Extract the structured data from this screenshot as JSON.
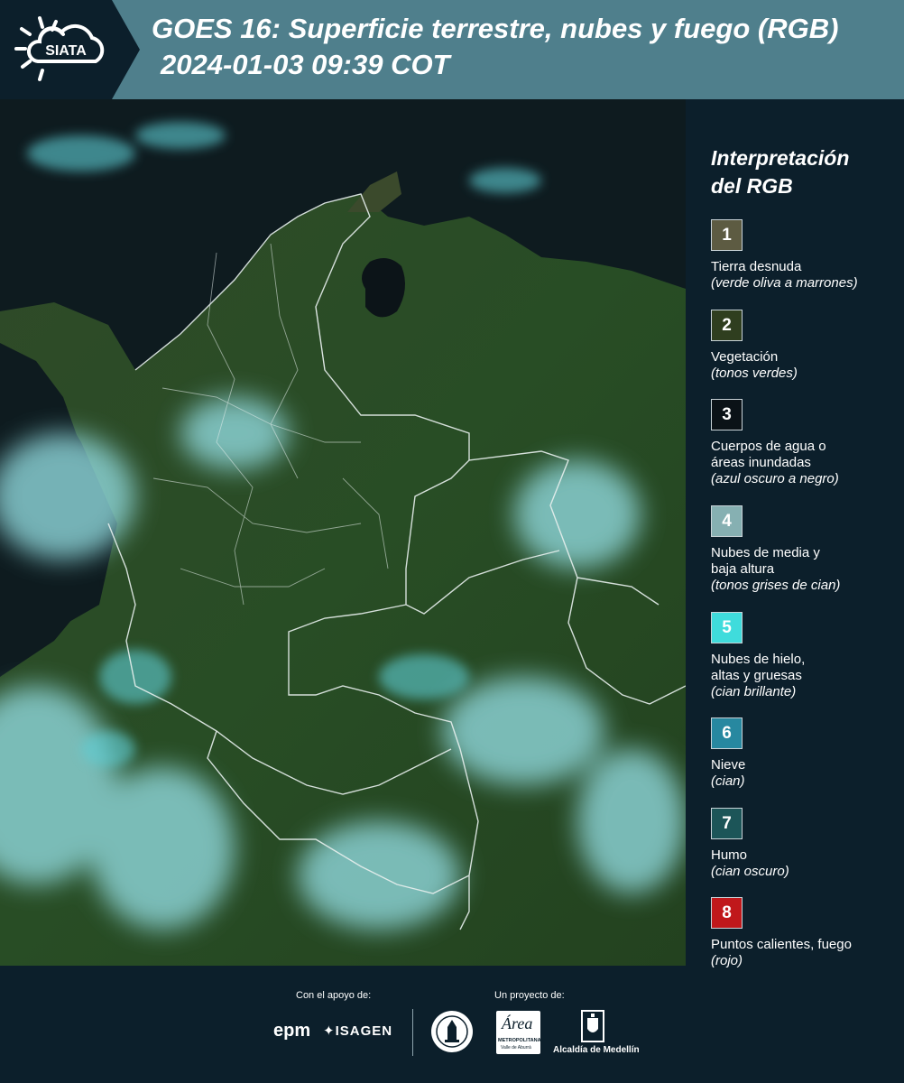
{
  "header": {
    "logo_text": "SIATA",
    "title_line1": "GOES 16: Superficie terrestre, nubes y fuego (RGB)",
    "title_line2": "2024-01-03 09:39 COT"
  },
  "legend": {
    "title_line1": "Interpretación",
    "title_line2": "del RGB",
    "items": [
      {
        "num": "1",
        "color": "#5d5b42",
        "label": "Tierra desnuda",
        "sub": "(verde oliva a marrones)"
      },
      {
        "num": "2",
        "color": "#2f3e1f",
        "label": "Vegetación",
        "sub": "(tonos verdes)"
      },
      {
        "num": "3",
        "color": "#0b1217",
        "label": "Cuerpos de agua o\náreas inundadas",
        "sub": "(azul oscuro a negro)"
      },
      {
        "num": "4",
        "color": "#86b0b2",
        "label": "Nubes de media y\nbaja altura",
        "sub": "(tonos grises de cian)"
      },
      {
        "num": "5",
        "color": "#3fdcdc",
        "label": "Nubes de hielo,\naltas y gruesas",
        "sub": "(cian brillante)"
      },
      {
        "num": "6",
        "color": "#2788a0",
        "label": "Nieve",
        "sub": "(cian)"
      },
      {
        "num": "7",
        "color": "#1c5558",
        "label": "Humo",
        "sub": "(cian oscuro)"
      },
      {
        "num": "8",
        "color": "#c0181b",
        "label": "Puntos calientes, fuego",
        "sub": "(rojo)"
      }
    ]
  },
  "footer": {
    "support_label": "Con el apoyo de:",
    "project_label": "Un proyecto de:",
    "epm": "epm",
    "isagen": "ISAGEN",
    "area_metropolitana": "METROPOLITANA",
    "area_valle": "Valle de Aburrá",
    "alcaldia": "Alcaldía de Medellín"
  }
}
